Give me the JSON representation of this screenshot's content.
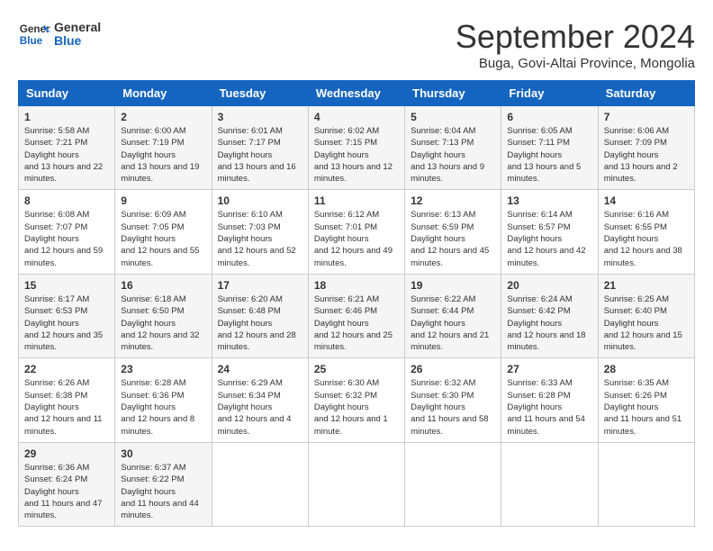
{
  "header": {
    "logo_line1": "General",
    "logo_line2": "Blue",
    "month_title": "September 2024",
    "subtitle": "Buga, Govi-Altai Province, Mongolia"
  },
  "weekdays": [
    "Sunday",
    "Monday",
    "Tuesday",
    "Wednesday",
    "Thursday",
    "Friday",
    "Saturday"
  ],
  "weeks": [
    [
      {
        "day": "1",
        "sunrise": "5:58 AM",
        "sunset": "7:21 PM",
        "daylight": "13 hours and 22 minutes."
      },
      {
        "day": "2",
        "sunrise": "6:00 AM",
        "sunset": "7:19 PM",
        "daylight": "13 hours and 19 minutes."
      },
      {
        "day": "3",
        "sunrise": "6:01 AM",
        "sunset": "7:17 PM",
        "daylight": "13 hours and 16 minutes."
      },
      {
        "day": "4",
        "sunrise": "6:02 AM",
        "sunset": "7:15 PM",
        "daylight": "13 hours and 12 minutes."
      },
      {
        "day": "5",
        "sunrise": "6:04 AM",
        "sunset": "7:13 PM",
        "daylight": "13 hours and 9 minutes."
      },
      {
        "day": "6",
        "sunrise": "6:05 AM",
        "sunset": "7:11 PM",
        "daylight": "13 hours and 5 minutes."
      },
      {
        "day": "7",
        "sunrise": "6:06 AM",
        "sunset": "7:09 PM",
        "daylight": "13 hours and 2 minutes."
      }
    ],
    [
      {
        "day": "8",
        "sunrise": "6:08 AM",
        "sunset": "7:07 PM",
        "daylight": "12 hours and 59 minutes."
      },
      {
        "day": "9",
        "sunrise": "6:09 AM",
        "sunset": "7:05 PM",
        "daylight": "12 hours and 55 minutes."
      },
      {
        "day": "10",
        "sunrise": "6:10 AM",
        "sunset": "7:03 PM",
        "daylight": "12 hours and 52 minutes."
      },
      {
        "day": "11",
        "sunrise": "6:12 AM",
        "sunset": "7:01 PM",
        "daylight": "12 hours and 49 minutes."
      },
      {
        "day": "12",
        "sunrise": "6:13 AM",
        "sunset": "6:59 PM",
        "daylight": "12 hours and 45 minutes."
      },
      {
        "day": "13",
        "sunrise": "6:14 AM",
        "sunset": "6:57 PM",
        "daylight": "12 hours and 42 minutes."
      },
      {
        "day": "14",
        "sunrise": "6:16 AM",
        "sunset": "6:55 PM",
        "daylight": "12 hours and 38 minutes."
      }
    ],
    [
      {
        "day": "15",
        "sunrise": "6:17 AM",
        "sunset": "6:53 PM",
        "daylight": "12 hours and 35 minutes."
      },
      {
        "day": "16",
        "sunrise": "6:18 AM",
        "sunset": "6:50 PM",
        "daylight": "12 hours and 32 minutes."
      },
      {
        "day": "17",
        "sunrise": "6:20 AM",
        "sunset": "6:48 PM",
        "daylight": "12 hours and 28 minutes."
      },
      {
        "day": "18",
        "sunrise": "6:21 AM",
        "sunset": "6:46 PM",
        "daylight": "12 hours and 25 minutes."
      },
      {
        "day": "19",
        "sunrise": "6:22 AM",
        "sunset": "6:44 PM",
        "daylight": "12 hours and 21 minutes."
      },
      {
        "day": "20",
        "sunrise": "6:24 AM",
        "sunset": "6:42 PM",
        "daylight": "12 hours and 18 minutes."
      },
      {
        "day": "21",
        "sunrise": "6:25 AM",
        "sunset": "6:40 PM",
        "daylight": "12 hours and 15 minutes."
      }
    ],
    [
      {
        "day": "22",
        "sunrise": "6:26 AM",
        "sunset": "6:38 PM",
        "daylight": "12 hours and 11 minutes."
      },
      {
        "day": "23",
        "sunrise": "6:28 AM",
        "sunset": "6:36 PM",
        "daylight": "12 hours and 8 minutes."
      },
      {
        "day": "24",
        "sunrise": "6:29 AM",
        "sunset": "6:34 PM",
        "daylight": "12 hours and 4 minutes."
      },
      {
        "day": "25",
        "sunrise": "6:30 AM",
        "sunset": "6:32 PM",
        "daylight": "12 hours and 1 minute."
      },
      {
        "day": "26",
        "sunrise": "6:32 AM",
        "sunset": "6:30 PM",
        "daylight": "11 hours and 58 minutes."
      },
      {
        "day": "27",
        "sunrise": "6:33 AM",
        "sunset": "6:28 PM",
        "daylight": "11 hours and 54 minutes."
      },
      {
        "day": "28",
        "sunrise": "6:35 AM",
        "sunset": "6:26 PM",
        "daylight": "11 hours and 51 minutes."
      }
    ],
    [
      {
        "day": "29",
        "sunrise": "6:36 AM",
        "sunset": "6:24 PM",
        "daylight": "11 hours and 47 minutes."
      },
      {
        "day": "30",
        "sunrise": "6:37 AM",
        "sunset": "6:22 PM",
        "daylight": "11 hours and 44 minutes."
      },
      null,
      null,
      null,
      null,
      null
    ]
  ]
}
